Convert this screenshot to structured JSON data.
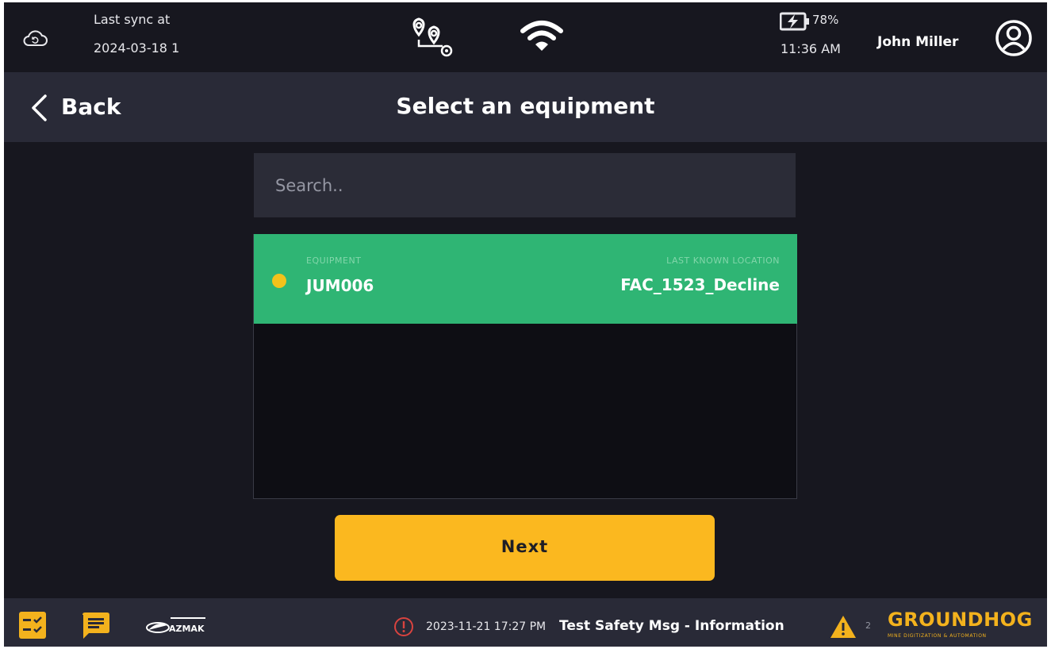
{
  "statusbar": {
    "sync_label": "Last sync at",
    "sync_time": "2024-03-18 1",
    "battery_pct": "78%",
    "clock": "11:36 AM",
    "user_name": "John Miller",
    "icons": [
      "cloud-sync-icon",
      "route-icon",
      "wifi-icon",
      "battery-charging-icon",
      "user-icon"
    ]
  },
  "header": {
    "back_label": "Back",
    "title": "Select an equipment"
  },
  "search": {
    "placeholder": "Search.."
  },
  "list": {
    "columns": [
      "EQUIPMENT",
      "LAST KNOWN LOCATION"
    ],
    "items": [
      {
        "id": "JUM006",
        "location": "FAC_1523_Decline",
        "status_color": "#f3c21b",
        "selected": true
      }
    ]
  },
  "actions": {
    "next_label": "Next"
  },
  "footer": {
    "alert_time": "2023-11-21 17:27 PM",
    "alert_text": "Test Safety Msg - Information",
    "warning_count": "2",
    "brand_name": "GROUNDHOG",
    "brand_tagline": "MINE DIGITIZATION & AUTOMATION",
    "partner_logo": "AZMAK",
    "icons": [
      "checklist-icon",
      "chat-icon",
      "alert-circle-icon",
      "warning-triangle-icon"
    ]
  },
  "colors": {
    "accent": "#fbb81f",
    "selected_row": "#2fb574",
    "background": "#17171f",
    "panel": "#292a37"
  }
}
